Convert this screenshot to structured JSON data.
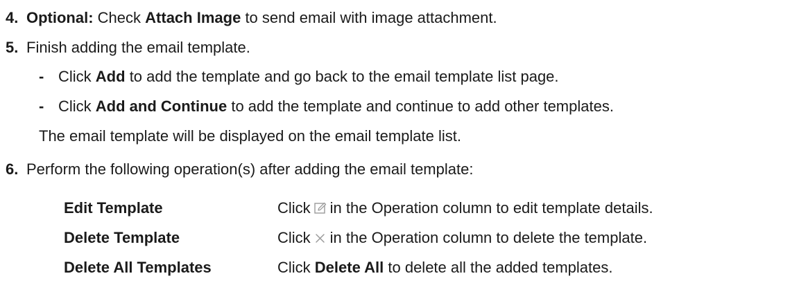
{
  "step4": {
    "number": "4.",
    "optional": "Optional:",
    "t1": "Check",
    "b1": "Attach Image",
    "t2": "to send email with image attachment."
  },
  "step5": {
    "number": "5.",
    "text": "Finish adding the email template.",
    "bullets": [
      {
        "dash": "-",
        "t1": "Click",
        "b1": "Add",
        "t2": "to add the template and go back to the email template list page."
      },
      {
        "dash": "-",
        "t1": "Click",
        "b1": "Add and Continue",
        "t2": "to add the template and continue to add other templates."
      }
    ],
    "result": "The email template will be displayed on the email template list."
  },
  "step6": {
    "number": "6.",
    "text": "Perform the following operation(s) after adding the email template:"
  },
  "operations": [
    {
      "term": "Edit Template",
      "t1": "Click",
      "icon": "edit-icon",
      "t2": "in the Operation column to edit template details."
    },
    {
      "term": "Delete Template",
      "t1": "Click",
      "icon": "close-icon",
      "t2": "in the Operation column to delete the template."
    },
    {
      "term": "Delete All Templates",
      "t1": "Click",
      "b1": "Delete All",
      "t2": "to delete all the added templates."
    }
  ],
  "colors": {
    "text": "#1a1a1a",
    "icon": "#9a9a9a"
  }
}
